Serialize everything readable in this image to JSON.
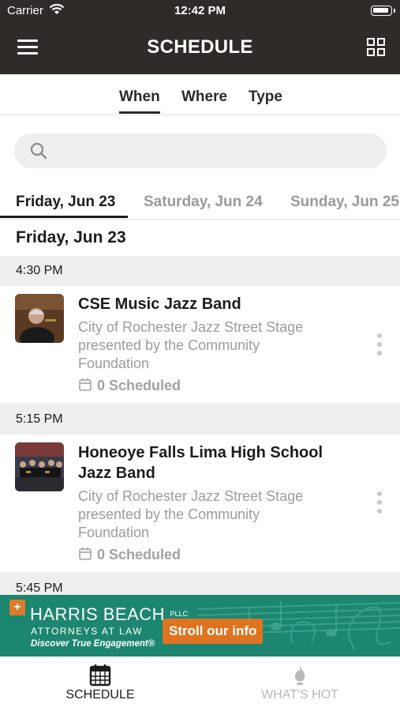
{
  "status_bar": {
    "carrier": "Carrier",
    "time": "12:42 PM"
  },
  "header": {
    "title": "SCHEDULE",
    "menu_icon": "hamburger-icon",
    "grid_icon": "grid-icon"
  },
  "filter_tabs": [
    {
      "label": "When",
      "active": true
    },
    {
      "label": "Where",
      "active": false
    },
    {
      "label": "Type",
      "active": false
    }
  ],
  "search": {
    "placeholder": ""
  },
  "day_tabs": [
    {
      "label": "Friday, Jun 23",
      "active": true
    },
    {
      "label": "Saturday, Jun 24",
      "active": false
    },
    {
      "label": "Sunday, Jun 25",
      "active": false
    }
  ],
  "date_heading": "Friday, Jun 23",
  "time_slots": [
    "4:30 PM",
    "5:15 PM",
    "5:45 PM"
  ],
  "events": [
    {
      "title": "CSE Music Jazz Band",
      "location": "City of Rochester Jazz Street Stage presented by the Community Foundation",
      "scheduled": "0 Scheduled"
    },
    {
      "title": "Honeoye Falls Lima High School Jazz Band",
      "location": "City of Rochester Jazz Street Stage presented by the Community Foundation",
      "scheduled": "0 Scheduled"
    }
  ],
  "ad": {
    "brand": "HARRIS BEACH",
    "brand_suffix": "PLLC",
    "subtitle": "ATTORNEYS AT LAW",
    "tagline": "Discover True Engagement®",
    "cta": "Stroll our info"
  },
  "tab_bar": [
    {
      "label": "SCHEDULE",
      "icon": "calendar-icon",
      "active": true
    },
    {
      "label": "WHAT'S HOT",
      "icon": "flame-icon",
      "active": false
    }
  ],
  "colors": {
    "header_bg": "#2f2b29",
    "ad_bg": "#1c8670",
    "ad_cta": "#e0731f",
    "muted": "#9c9c9c"
  }
}
